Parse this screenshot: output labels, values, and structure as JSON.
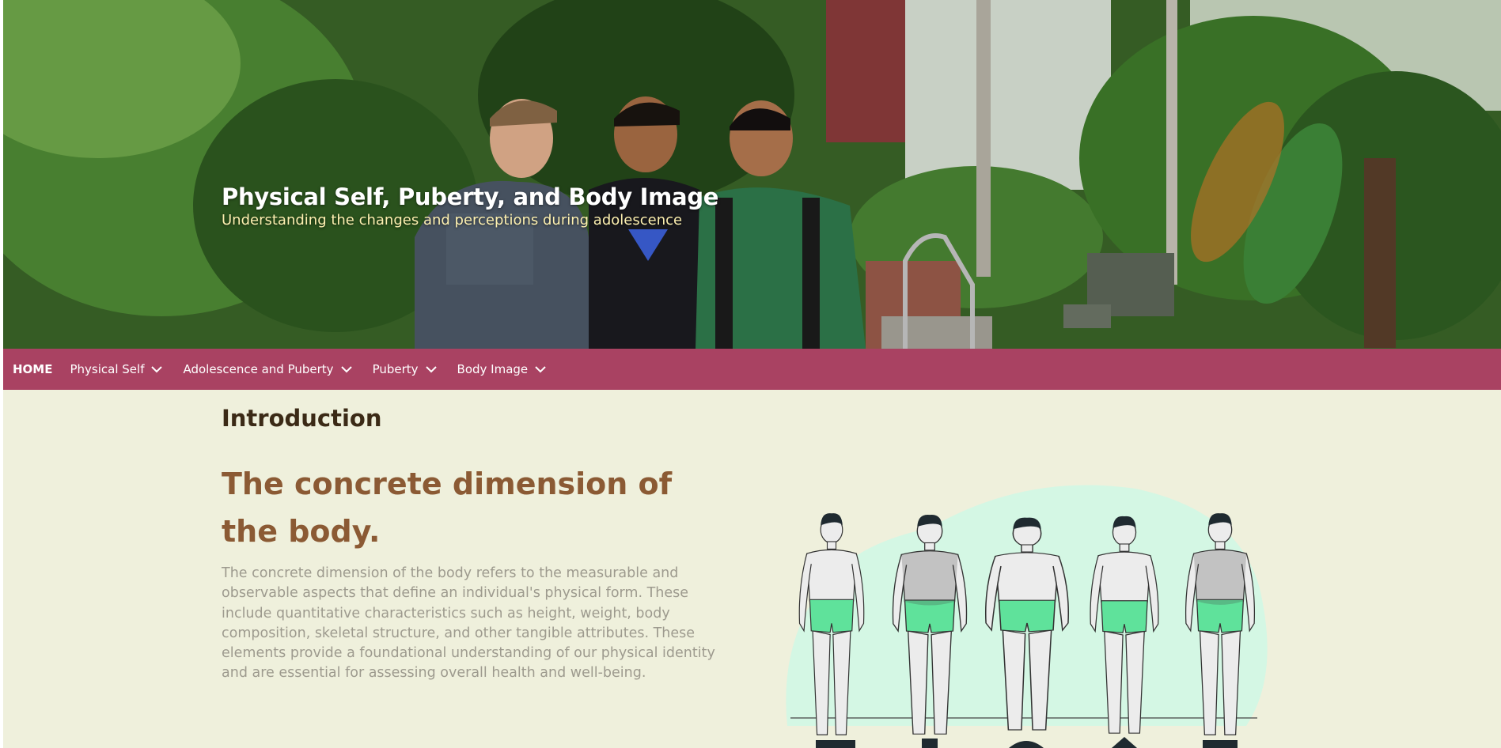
{
  "hero": {
    "title": "Physical Self, Puberty, and Body Image",
    "subtitle": "Understanding the changes and perceptions during adolescence"
  },
  "nav": {
    "home": "HOME",
    "items": [
      {
        "label": "Physical Self"
      },
      {
        "label": "Adolescence and Puberty"
      },
      {
        "label": "Puberty"
      },
      {
        "label": "Body Image"
      }
    ]
  },
  "main": {
    "intro_heading": "Introduction",
    "section_heading": "The concrete dimension of the body.",
    "paragraph": "The concrete dimension of the body refers to the measurable and observable aspects that define an individual's physical form. These include quantitative characteristics such as height, weight, body composition, skeletal structure, and other tangible attributes. These elements provide a foundational understanding of our physical identity and are essential for assessing overall health and well-being."
  },
  "colors": {
    "page_background": "#eff0dc",
    "nav_background": "#a94262",
    "section_heading": "#8b5a34",
    "paragraph": "#9d9a8e",
    "accent_mint": "#d4f7e4",
    "shorts": "#5fe29b"
  },
  "icons": {
    "nav_chevron": "chevron-down-icon"
  }
}
